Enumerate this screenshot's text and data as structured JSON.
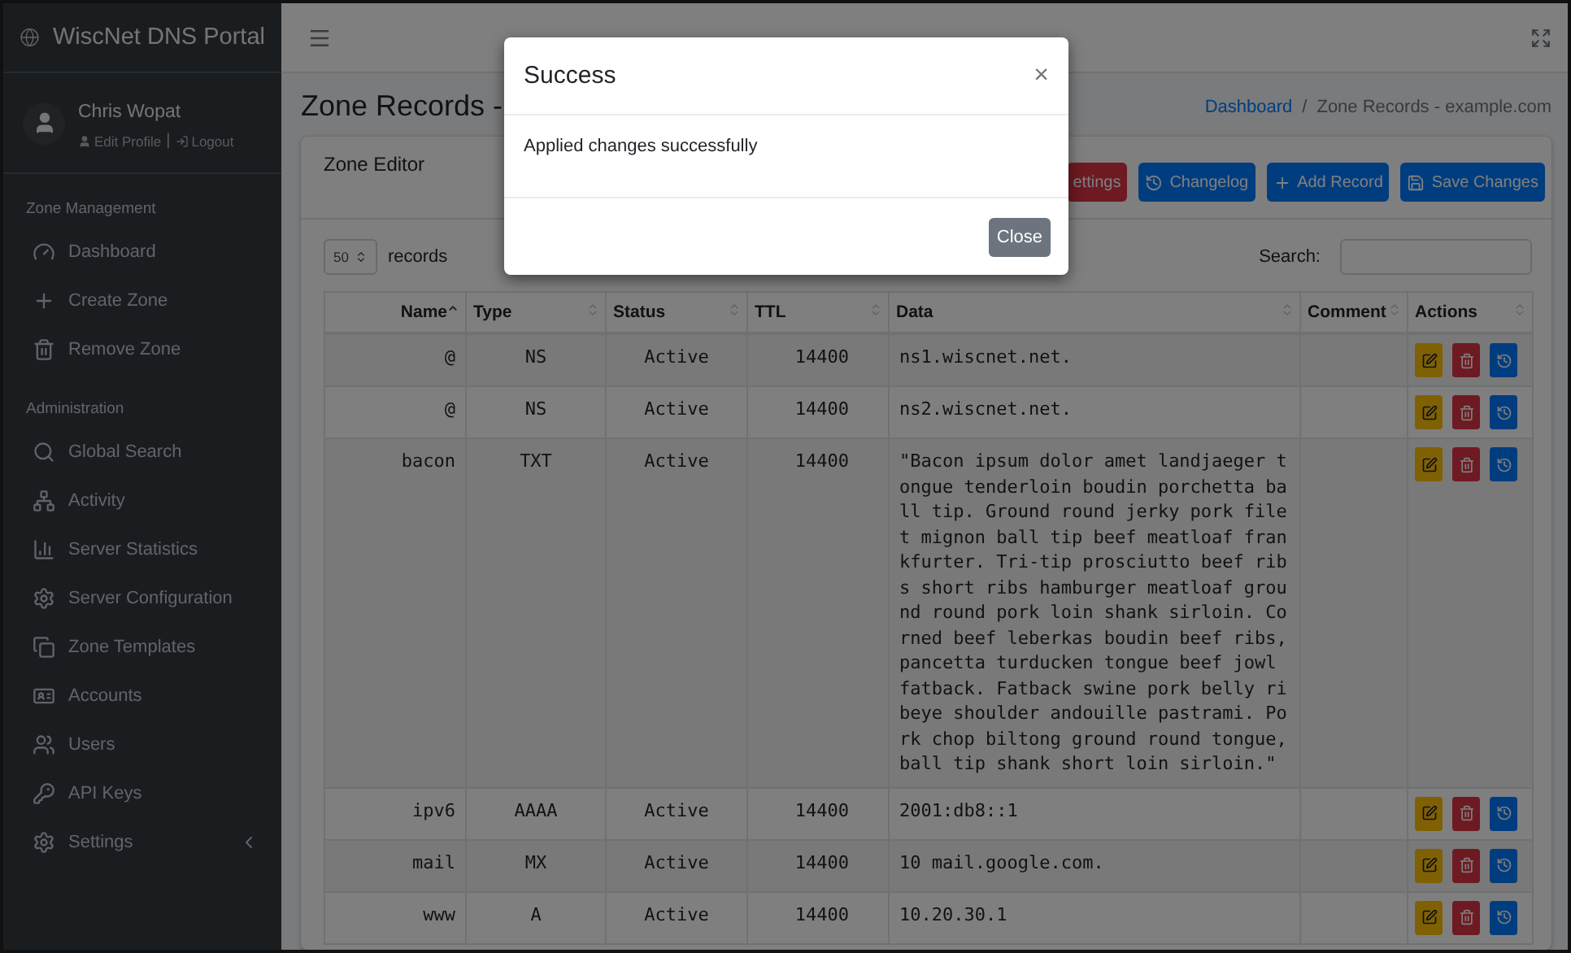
{
  "brand": {
    "title": "WiscNet DNS Portal"
  },
  "user": {
    "name": "Chris Wopat",
    "links": [
      "Edit Profile",
      "Logout"
    ],
    "separator": "|"
  },
  "sidebar": {
    "sections": [
      {
        "heading": "Zone Management",
        "items": [
          {
            "label": "Dashboard",
            "has_submenu": false
          },
          {
            "label": "Create Zone",
            "has_submenu": false
          },
          {
            "label": "Remove Zone",
            "has_submenu": false
          }
        ]
      },
      {
        "heading": "Administration",
        "items": [
          {
            "label": "Global Search",
            "has_submenu": false
          },
          {
            "label": "Activity",
            "has_submenu": false
          },
          {
            "label": "Server Statistics",
            "has_submenu": false
          },
          {
            "label": "Server Configuration",
            "has_submenu": false
          },
          {
            "label": "Zone Templates",
            "has_submenu": false
          },
          {
            "label": "Accounts",
            "has_submenu": false
          },
          {
            "label": "Users",
            "has_submenu": false
          },
          {
            "label": "API Keys",
            "has_submenu": false
          },
          {
            "label": "Settings",
            "has_submenu": true
          }
        ]
      }
    ]
  },
  "page": {
    "title": "Zone Records -",
    "breadcrumb": [
      "Dashboard",
      "Zone Records - example.com"
    ],
    "breadcrumb_separator": "/"
  },
  "card": {
    "title": "Zone Editor",
    "buttons": [
      {
        "label": "ettings",
        "kind": "danger"
      },
      {
        "label": "Changelog",
        "kind": "primary"
      },
      {
        "label": "Add Record",
        "kind": "primary"
      },
      {
        "label": "Save Changes",
        "kind": "primary"
      }
    ]
  },
  "table_controls": {
    "page_size": "50",
    "page_size_label": "records",
    "search_label": "Search:"
  },
  "table": {
    "columns": [
      {
        "label": "Name",
        "sorted": true
      },
      {
        "label": "Type",
        "sorted": false
      },
      {
        "label": "Status",
        "sorted": false
      },
      {
        "label": "TTL",
        "sorted": false
      },
      {
        "label": "Data",
        "sorted": false
      },
      {
        "label": "Comment",
        "sorted": false
      },
      {
        "label": "Actions",
        "sorted": false
      }
    ],
    "rows": [
      {
        "name": "@",
        "type": "NS",
        "status": "Active",
        "ttl": "14400",
        "data": "ns1.wiscnet.net."
      },
      {
        "name": "@",
        "type": "NS",
        "status": "Active",
        "ttl": "14400",
        "data": "ns2.wiscnet.net."
      },
      {
        "name": "bacon",
        "type": "TXT",
        "status": "Active",
        "ttl": "14400",
        "data": "\"Bacon ipsum dolor amet landjaeger tongue tenderloin boudin porchetta ball tip. Ground round jerky pork filet mignon ball tip beef meatloaf frankfurter. Tri-tip prosciutto beef ribs short ribs hamburger meatloaf ground round pork loin shank sirloin. Corned beef leberkas boudin beef ribs, pancetta turducken tongue beef jowl fatback. Fatback swine pork belly ribeye shoulder andouille pastrami. Pork chop biltong ground round tongue, ball tip shank short loin sirloin.\""
      },
      {
        "name": "ipv6",
        "type": "AAAA",
        "status": "Active",
        "ttl": "14400",
        "data": "2001:db8::1"
      },
      {
        "name": "mail",
        "type": "MX",
        "status": "Active",
        "ttl": "14400",
        "data": "10 mail.google.com."
      },
      {
        "name": "www",
        "type": "A",
        "status": "Active",
        "ttl": "14400",
        "data": "10.20.30.1"
      }
    ]
  },
  "modal": {
    "title": "Success",
    "close_glyph": "×",
    "message": "Applied changes successfully",
    "button": "Close"
  }
}
